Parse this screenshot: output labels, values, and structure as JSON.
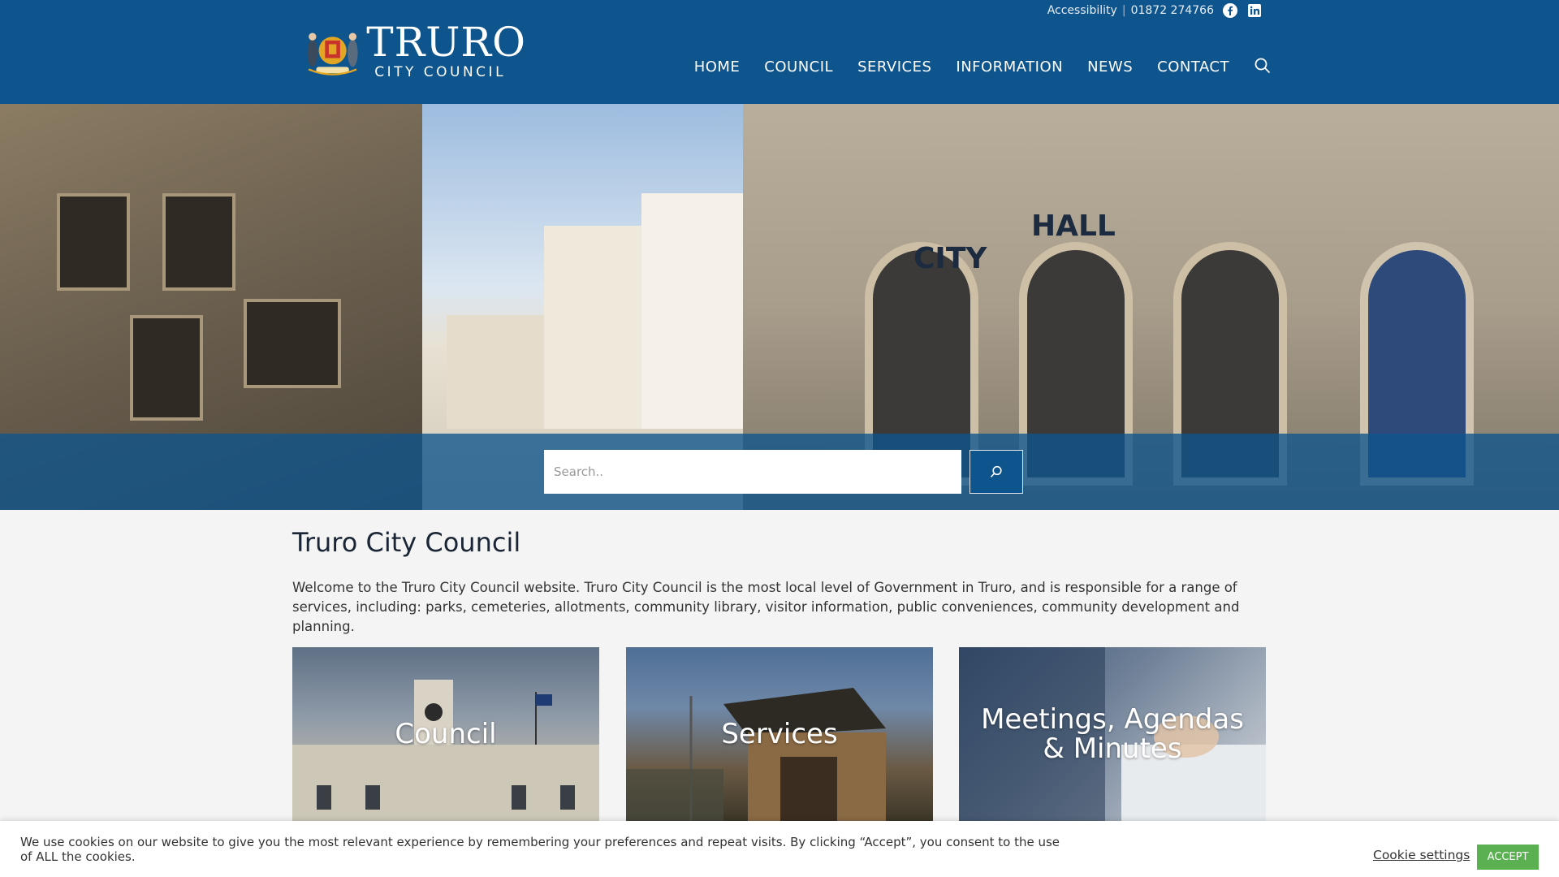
{
  "header": {
    "logo": {
      "main": "TRURO",
      "sub": "CITY COUNCIL"
    },
    "topbar": {
      "accessibility": "Accessibility",
      "separator": "|",
      "phone": "01872 274766"
    },
    "nav": [
      "HOME",
      "COUNCIL",
      "SERVICES",
      "INFORMATION",
      "NEWS",
      "CONTACT"
    ]
  },
  "hero": {
    "signs": {
      "city": "CITY",
      "hall": "HALL"
    },
    "search": {
      "placeholder": "Search.."
    }
  },
  "main": {
    "title": "Truro City Council",
    "intro": "Welcome to the Truro City Council website. Truro City Council is the most local level of Government in Truro, and is responsible for a range of services, including: parks, cemeteries, allotments, community library, visitor information, public conveniences, community development and planning.",
    "cards": [
      {
        "title": "Council"
      },
      {
        "title": "Services"
      },
      {
        "title": "Meetings, Agendas & Minutes"
      }
    ]
  },
  "cookie": {
    "text": "We use cookies on our website to give you the most relevant experience by remembering your preferences and repeat visits. By clicking “Accept”, you consent to the use of ALL the cookies.",
    "settings": "Cookie settings",
    "accept": "ACCEPT"
  },
  "colors": {
    "brand": "#0e548d",
    "accept": "#5bb152"
  }
}
